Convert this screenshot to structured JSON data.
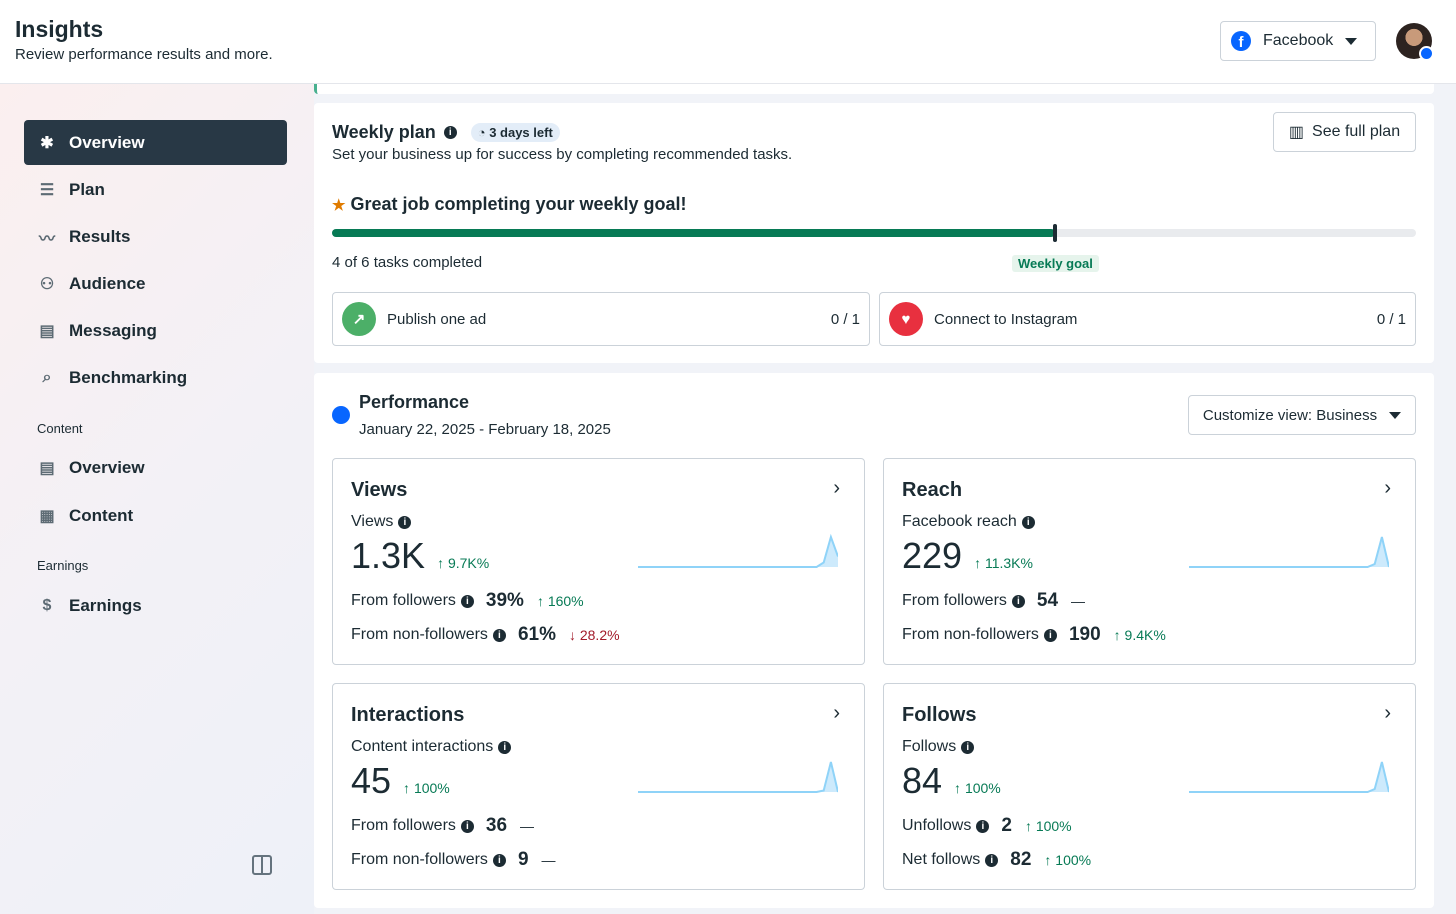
{
  "header": {
    "title": "Insights",
    "subtitle": "Review performance results and more.",
    "platform": "Facebook"
  },
  "sidebar": {
    "items": [
      {
        "label": "Overview",
        "icon": "overview-icon"
      },
      {
        "label": "Plan",
        "icon": "list-icon"
      },
      {
        "label": "Results",
        "icon": "chart-icon"
      },
      {
        "label": "Audience",
        "icon": "people-icon"
      },
      {
        "label": "Messaging",
        "icon": "message-icon"
      },
      {
        "label": "Benchmarking",
        "icon": "search-icon"
      }
    ],
    "content_section": "Content",
    "content_items": [
      {
        "label": "Overview"
      },
      {
        "label": "Content"
      }
    ],
    "earnings_section": "Earnings",
    "earnings_items": [
      {
        "label": "Earnings"
      }
    ]
  },
  "weekly_plan": {
    "title": "Weekly plan",
    "badge": "3 days left",
    "description": "Set your business up for success by completing recommended tasks.",
    "see_full_plan": "See full plan",
    "goal_message": "Great job completing your weekly goal!",
    "progress_text": "4 of 6 tasks completed",
    "completed": 4,
    "total": 6,
    "goal_label": "Weekly goal",
    "tasks": [
      {
        "label": "Publish one ad",
        "count": "0 / 1"
      },
      {
        "label": "Connect to Instagram",
        "count": "0 / 1"
      }
    ]
  },
  "performance": {
    "title": "Performance",
    "date_range": "January 22, 2025 - February 18, 2025",
    "customize": "Customize view: Business",
    "cards": [
      {
        "title": "Views",
        "metric": "Views",
        "value": "1.3K",
        "change": "9.7K%",
        "dir": "up",
        "rows": [
          {
            "label": "From followers",
            "value": "39%",
            "change": "160%",
            "dir": "up"
          },
          {
            "label": "From non-followers",
            "value": "61%",
            "change": "28.2%",
            "dir": "down"
          }
        ],
        "spark": [
          0,
          0,
          0,
          0,
          0,
          0,
          0,
          0,
          0,
          0,
          0,
          0,
          0,
          0,
          0,
          0,
          0,
          0,
          0,
          0,
          0,
          0,
          0,
          0,
          0,
          0,
          0.15,
          1,
          0.35
        ]
      },
      {
        "title": "Reach",
        "metric": "Facebook reach",
        "value": "229",
        "change": "11.3K%",
        "dir": "up",
        "rows": [
          {
            "label": "From followers",
            "value": "54",
            "change": "—",
            "dir": "flat"
          },
          {
            "label": "From non-followers",
            "value": "190",
            "change": "9.4K%",
            "dir": "up"
          }
        ],
        "spark": [
          0,
          0,
          0,
          0,
          0,
          0,
          0,
          0,
          0,
          0,
          0,
          0,
          0,
          0,
          0,
          0,
          0,
          0,
          0,
          0,
          0,
          0,
          0,
          0,
          0,
          0,
          0.1,
          1,
          0
        ]
      },
      {
        "title": "Interactions",
        "metric": "Content interactions",
        "value": "45",
        "change": "100%",
        "dir": "up",
        "rows": [
          {
            "label": "From followers",
            "value": "36",
            "change": "—",
            "dir": "flat"
          },
          {
            "label": "From non-followers",
            "value": "9",
            "change": "—",
            "dir": "flat"
          }
        ],
        "spark": [
          0,
          0,
          0,
          0,
          0,
          0,
          0,
          0,
          0,
          0,
          0,
          0,
          0,
          0,
          0,
          0,
          0,
          0,
          0,
          0,
          0,
          0,
          0,
          0,
          0,
          0,
          0.05,
          1,
          0
        ]
      },
      {
        "title": "Follows",
        "metric": "Follows",
        "value": "84",
        "change": "100%",
        "dir": "up",
        "rows": [
          {
            "label": "Unfollows",
            "value": "2",
            "change": "100%",
            "dir": "up"
          },
          {
            "label": "Net follows",
            "value": "82",
            "change": "100%",
            "dir": "up"
          }
        ],
        "spark": [
          0,
          0,
          0,
          0,
          0,
          0,
          0,
          0,
          0,
          0,
          0,
          0,
          0,
          0,
          0,
          0,
          0,
          0,
          0,
          0,
          0,
          0,
          0,
          0,
          0,
          0,
          0.1,
          1,
          0
        ]
      }
    ]
  },
  "colors": {
    "accent": "#077a55",
    "nav_active": "#283845",
    "facebook": "#0866ff",
    "spark": "#8fd3f8",
    "down": "#a21b2a"
  }
}
